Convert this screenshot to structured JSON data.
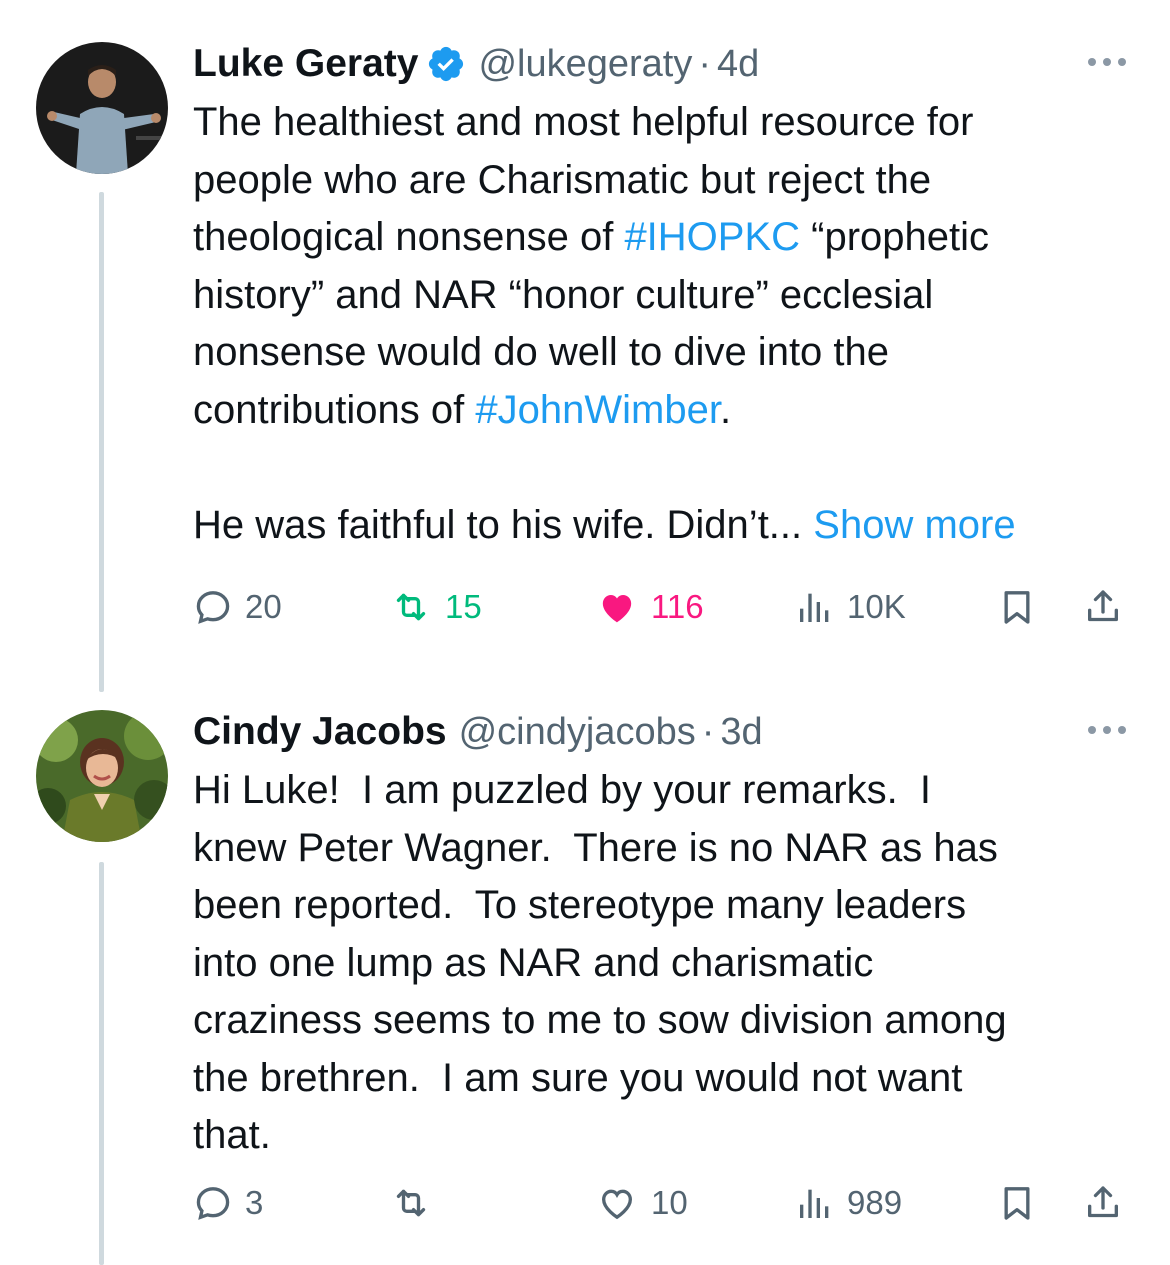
{
  "tweets": [
    {
      "author": "Luke Geraty",
      "verified": true,
      "handle": "@lukegeraty",
      "separator": "·",
      "time": "4d",
      "lines": [
        [
          {
            "t": "The healthiest and most helpful resource for"
          }
        ],
        [
          {
            "t": "people who are Charismatic but reject the"
          }
        ],
        [
          {
            "t": "theological nonsense of "
          },
          {
            "t": "#IHOPKC",
            "link": true
          },
          {
            "t": " “prophetic"
          }
        ],
        [
          {
            "t": "history” and NAR “honor culture” ecclesial"
          }
        ],
        [
          {
            "t": "nonsense would do well to dive into the"
          }
        ],
        [
          {
            "t": "contributions of "
          },
          {
            "t": "#JohnWimber",
            "link": true
          },
          {
            "t": "."
          }
        ],
        [],
        [
          {
            "t": "He was faithful to his wife. Didn’t... "
          },
          {
            "t": "Show more",
            "link": true
          }
        ]
      ],
      "metrics": {
        "replies": "20",
        "reposts": "15",
        "likes": "116",
        "views": "10K"
      },
      "liked": true,
      "reposted": true
    },
    {
      "author": "Cindy Jacobs",
      "verified": false,
      "handle": "@cindyjacobs",
      "separator": "·",
      "time": "3d",
      "lines": [
        [
          {
            "t": "Hi Luke!  I am puzzled by your remarks.  I"
          }
        ],
        [
          {
            "t": "knew Peter Wagner.  There is no NAR as has"
          }
        ],
        [
          {
            "t": "been reported.  To stereotype many leaders"
          }
        ],
        [
          {
            "t": "into one lump as NAR and charismatic"
          }
        ],
        [
          {
            "t": "craziness seems to me to sow division among"
          }
        ],
        [
          {
            "t": "the brethren.  I am sure you would not want"
          }
        ],
        [
          {
            "t": "that."
          }
        ]
      ],
      "metrics": {
        "replies": "3",
        "reposts": "",
        "likes": "10",
        "views": "989"
      },
      "liked": false,
      "reposted": false
    }
  ],
  "icons": {
    "reply": "reply-icon",
    "repost": "repost-icon",
    "like": "heart-icon",
    "views": "views-icon",
    "bookmark": "bookmark-icon",
    "share": "share-icon",
    "more": "more-icon",
    "verified": "verified-badge-icon"
  },
  "colors": {
    "link": "#1d9bf0",
    "secondary": "#536471",
    "repost_active": "#00ba7c",
    "like_active": "#f91880"
  }
}
